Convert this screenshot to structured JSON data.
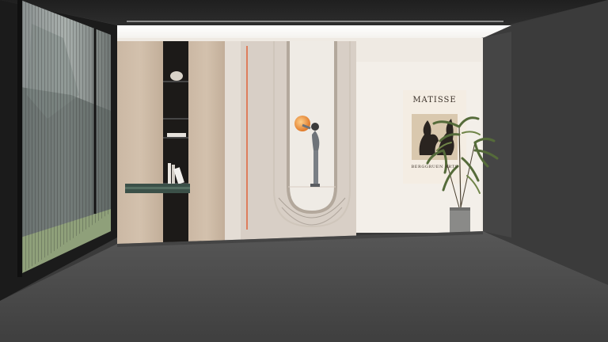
{
  "poster": {
    "title": "MATISSE",
    "caption": "BERGGRUEN ARTS"
  },
  "colors": {
    "floor": "#4b4b4b",
    "back_wall": "#f0ebe4",
    "side_wall": "#3c3c3c",
    "wood_panel": "#c9b7a4",
    "cream_wall": "#d7cfc6",
    "poster_cutout": "#8a6a4a"
  },
  "icons": [
    "wall-lamp-icon",
    "potted-plant-icon",
    "vase-icon",
    "books-icon"
  ]
}
